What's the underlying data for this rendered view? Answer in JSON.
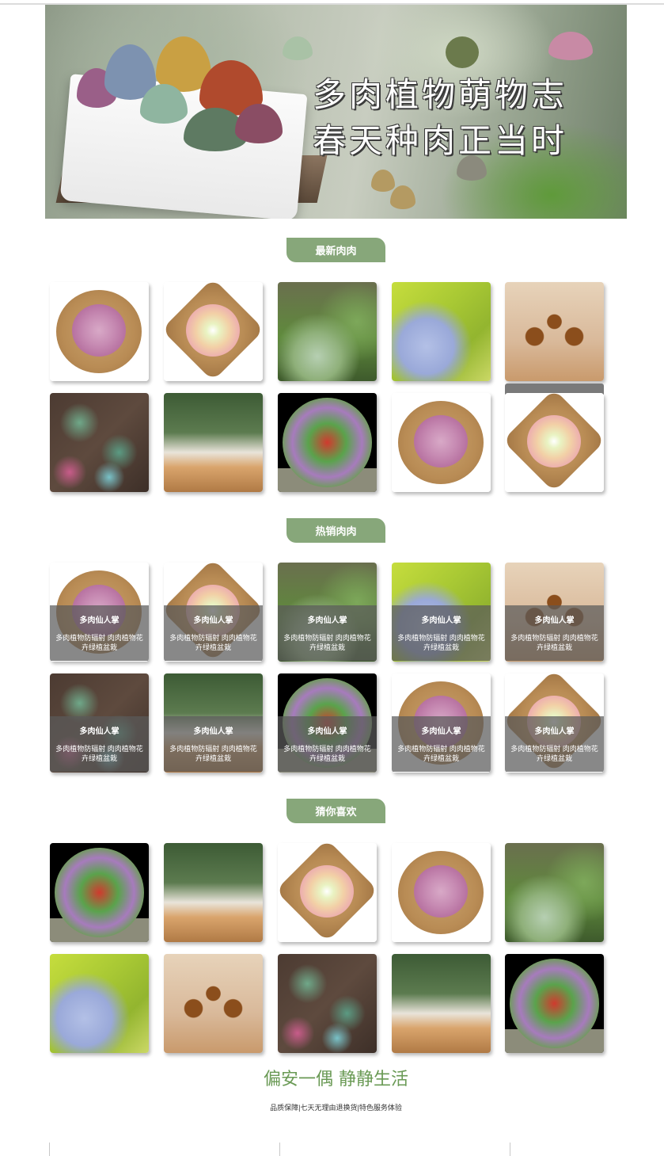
{
  "banner": {
    "line1": "多肉植物萌物志",
    "line2": "春天种肉正当时"
  },
  "sections": {
    "newest": "最新肉肉",
    "hot": "热销肉肉",
    "guess": "猜你喜欢"
  },
  "product_caption": {
    "title": "多肉仙人掌",
    "desc": "多肉植物防辐射 肉肉植物花卉绿植盆栽"
  },
  "footer": {
    "slogan": "偏安一偶 静静生活",
    "tagline": "品质保障|七天无理由退换货|特色服务体验"
  },
  "colors": {
    "accent_green": "#87a77a",
    "slogan_green": "#6a9a55"
  }
}
